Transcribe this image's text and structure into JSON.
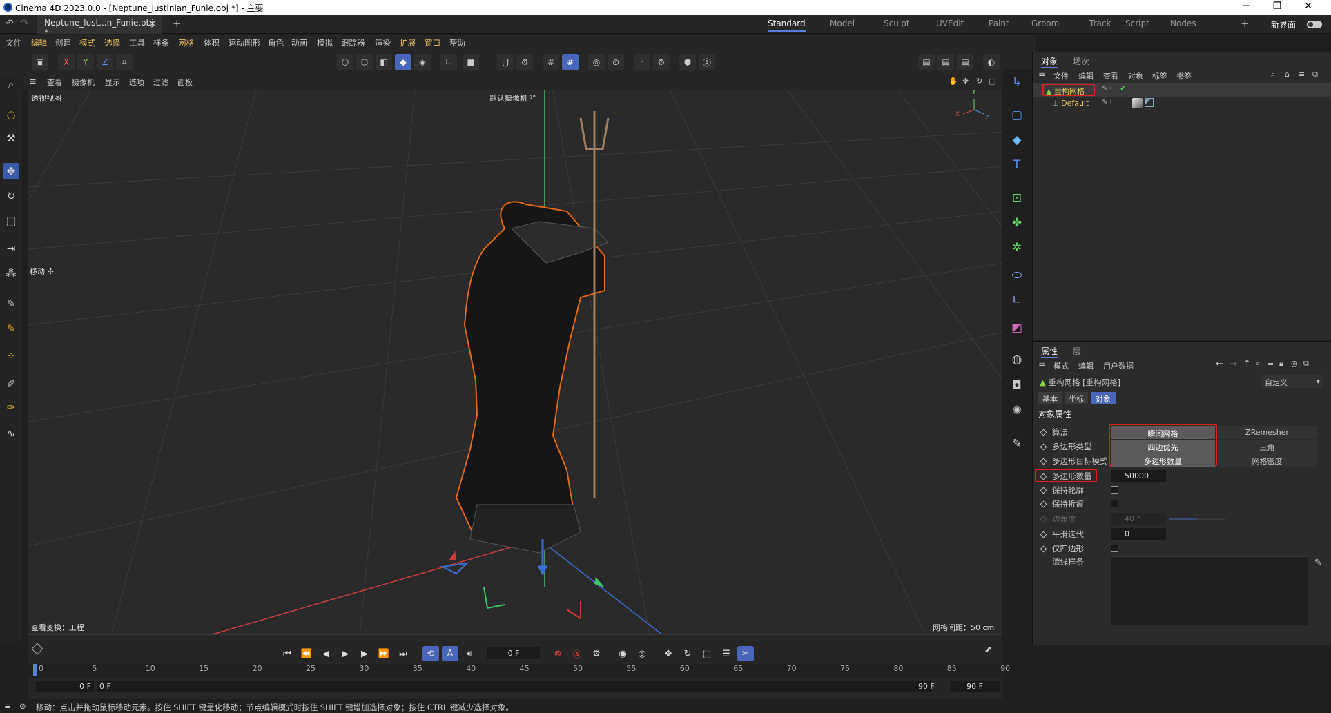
{
  "window": {
    "title": "Cinema 4D 2023.0.0 - [Neptune_lustinian_Funie.obj *] - 主要",
    "min": "─",
    "max": "❐",
    "close": "✕"
  },
  "tabs": {
    "doc": "Neptune_lust...n_Funie.obj *",
    "close": "×",
    "add": "+",
    "workspaces": [
      "Standard",
      "Model",
      "Sculpt",
      "UVEdit",
      "Paint",
      "Groom",
      "Track",
      "Script",
      "Nodes"
    ],
    "plus": "+",
    "new_ui": "新界面"
  },
  "menu": [
    "文件",
    "编辑",
    "创建",
    "模式",
    "选择",
    "工具",
    "样条",
    "网格",
    "体积",
    "运动图形",
    "角色",
    "动画",
    "模拟",
    "跟踪器",
    "渲染",
    "扩展",
    "窗口",
    "帮助"
  ],
  "toolbar": {
    "x": "X",
    "y": "Y",
    "z": "Z"
  },
  "viewport": {
    "menu": [
      "查看",
      "摄像机",
      "显示",
      "选项",
      "过滤",
      "面板"
    ],
    "view_name": "透视视图",
    "camera": "默认摄像机 ·̂°",
    "move_label": "移动 ✣",
    "transform": "查看变换：工程",
    "grid": "网格间距：50 cm",
    "axis": {
      "x": "X",
      "y": "Y",
      "z": "Z"
    }
  },
  "objects": {
    "tabs": [
      "对象",
      "场次"
    ],
    "menu": [
      "文件",
      "编辑",
      "查看",
      "对象",
      "标签",
      "书签"
    ],
    "items": [
      {
        "name": "重构网格"
      },
      {
        "name": "Default"
      }
    ]
  },
  "attributes": {
    "tabs": [
      "属性",
      "层"
    ],
    "menu": [
      "模式",
      "编辑",
      "用户数据"
    ],
    "object_title": "重构网格 [重构网格]",
    "preset": "自定义",
    "subtabs": [
      "基本",
      "坐标",
      "对象"
    ],
    "section": "对象属性",
    "rows": [
      {
        "label": "算法",
        "opt1": "瞬间网格",
        "opt2": "ZRemesher"
      },
      {
        "label": "多边形类型",
        "opt1": "四边优先",
        "opt2": "三角"
      },
      {
        "label": "多边形目标模式",
        "opt1": "多边形数量",
        "opt2": "网格密度"
      }
    ],
    "poly_count": {
      "label": "多边形数量",
      "value": "50000"
    },
    "keep_outline": "保持轮廓",
    "keep_crease": "保持折痕",
    "edge_angle": {
      "label": "边角度",
      "value": "40 °"
    },
    "smooth": {
      "label": "平滑迭代",
      "value": "0"
    },
    "quads_only": "仅四边形",
    "flow": "流线样条"
  },
  "timeline": {
    "frame": "0 F",
    "start": "0 F",
    "start2": "0 F",
    "end": "90 F",
    "end2": "90 F",
    "ticks": [
      "0",
      "5",
      "10",
      "15",
      "20",
      "25",
      "30",
      "35",
      "40",
      "45",
      "50",
      "55",
      "60",
      "65",
      "70",
      "75",
      "80",
      "85",
      "90"
    ]
  },
  "status": "移动：点击并拖动鼠标移动元素。按住 SHIFT 键量化移动；节点编辑模式时按住 SHIFT 键增加选择对象；按住 CTRL 键减少选择对象。"
}
